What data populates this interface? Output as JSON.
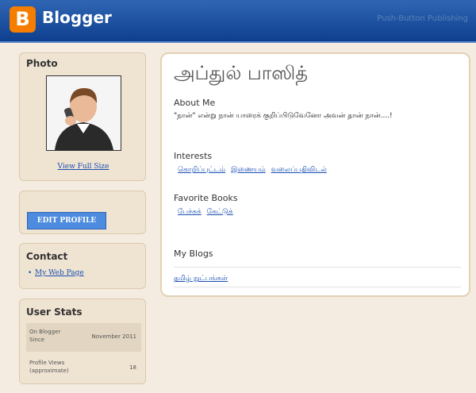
{
  "header": {
    "logo_letter": "B",
    "logo_text": "Blogger",
    "tagline": "Push-Button Publishing"
  },
  "sidebar": {
    "photo": {
      "title": "Photo",
      "view_full_size": "View Full Size"
    },
    "edit_profile_label": "EDIT PROFILE",
    "contact": {
      "title": "Contact",
      "web_page_link": "My Web Page"
    },
    "user_stats": {
      "title": "User Stats",
      "rows": [
        {
          "label": "On Blogger Since",
          "value": "November 2011"
        },
        {
          "label": "Profile Views (approximate)",
          "value": "18"
        }
      ]
    }
  },
  "profile": {
    "name": "அப்துல் பாஸித்",
    "about_title": "About Me",
    "about_text": "\"நான்\" என்று நான் யாரைக் குறிப்பிடுவேனோ அவன் தான் நான்....!",
    "interests_title": "Interests",
    "interests": [
      "கொறிப்புட்டம்",
      "இணையம்",
      "வலைப்பதிவிடல்"
    ],
    "books_title": "Favorite Books",
    "books": [
      "பேச்சுக்",
      "கேட்டுக்"
    ],
    "blogs_title": "My Blogs",
    "blogs": [
      "தமிழ் நுட்பங்கள்"
    ]
  },
  "colors": {
    "header_blue": "#0e3f8f",
    "logo_orange": "#f57d00",
    "link_blue": "#1a4fb3",
    "button_blue": "#4d8bdf",
    "page_bg": "#f4ece0"
  }
}
